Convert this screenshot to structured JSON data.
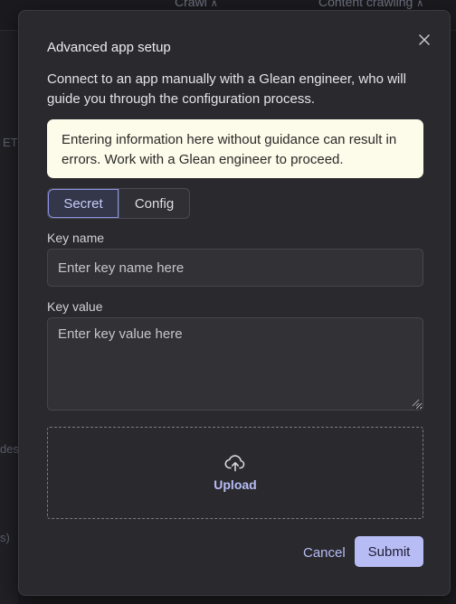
{
  "background": {
    "tabs": [
      {
        "label": "Crawl",
        "icon": "chevron-up-icon"
      },
      {
        "label": "Content crawling",
        "icon": "chevron-up-icon"
      }
    ],
    "fragments": [
      "ET",
      "des",
      "s)"
    ]
  },
  "modal": {
    "title": "Advanced app setup",
    "close_icon": "close-icon",
    "description": "Connect to an app manually with a Glean engineer, who will guide you through the configuration process.",
    "warning": "Entering information here without guidance can result in errors. Work with a Glean engineer to proceed.",
    "tabs": [
      {
        "label": "Secret",
        "selected": true
      },
      {
        "label": "Config",
        "selected": false
      }
    ],
    "key_name": {
      "label": "Key name",
      "placeholder": "Enter key name here",
      "value": ""
    },
    "key_value": {
      "label": "Key value",
      "placeholder": "Enter key value here",
      "value": ""
    },
    "upload": {
      "label": "Upload",
      "icon": "cloud-upload-icon"
    },
    "cancel_label": "Cancel",
    "submit_label": "Submit"
  },
  "colors": {
    "accent": "#b8bcf4",
    "warning_bg": "#fdfbe9",
    "modal_bg": "#2a2a2e"
  }
}
